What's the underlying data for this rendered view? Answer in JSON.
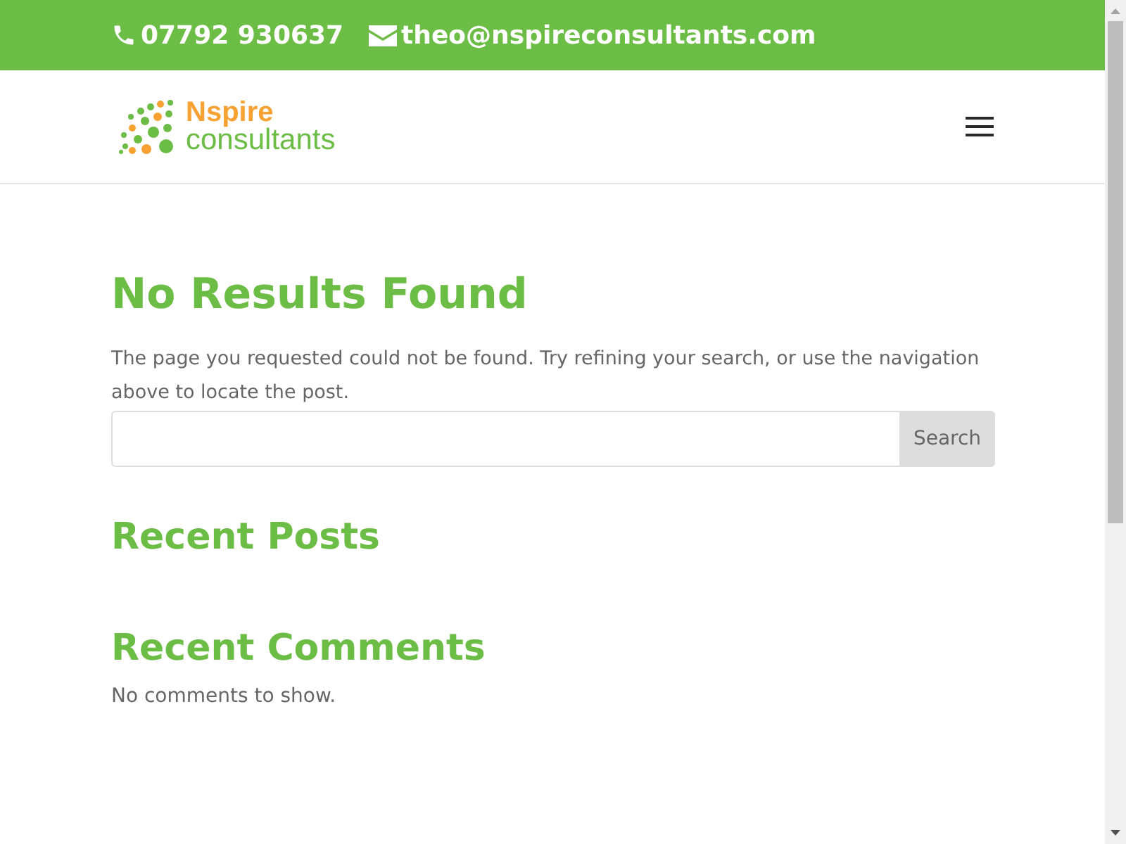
{
  "top_bar": {
    "phone": "07792 930637",
    "email": "theo@nspireconsultants.com"
  },
  "header": {
    "logo_line_1": "Nspire",
    "logo_line_2": "consultants"
  },
  "main": {
    "title": "No Results Found",
    "message": "The page you requested could not be found. Try refining your search, or use the navigation above to locate the post.",
    "search_button": "Search"
  },
  "sidebar": [
    {
      "title": "Recent Posts"
    },
    {
      "title": "Recent Comments",
      "text": "No comments to show."
    }
  ]
}
